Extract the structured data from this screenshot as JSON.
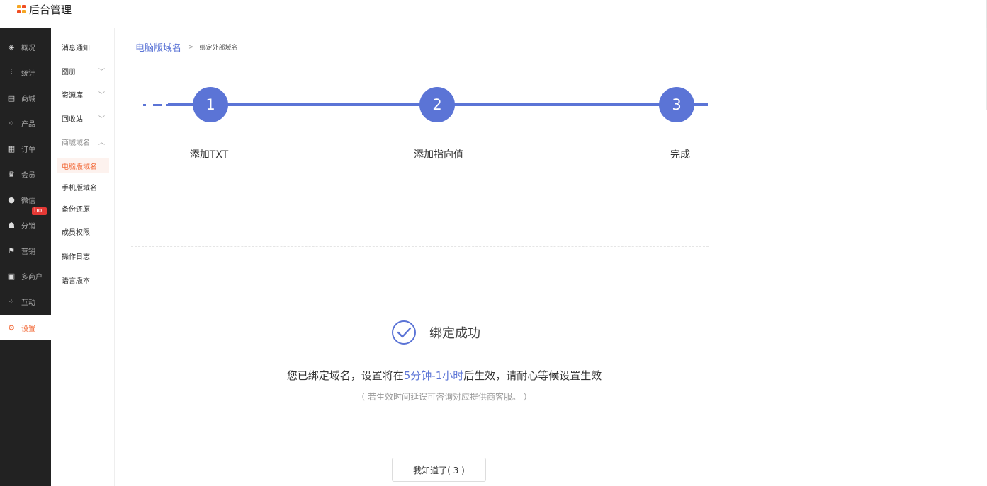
{
  "app": {
    "title": "后台管理"
  },
  "sidebar": {
    "items": [
      {
        "label": "概况",
        "icon": "layers-icon",
        "glyph": "◈"
      },
      {
        "label": "统计",
        "icon": "chart-icon",
        "glyph": "⫶"
      },
      {
        "label": "商城",
        "icon": "store-icon",
        "glyph": "▤"
      },
      {
        "label": "产品",
        "icon": "grid-icon",
        "glyph": "⁘"
      },
      {
        "label": "订单",
        "icon": "order-icon",
        "glyph": "▦"
      },
      {
        "label": "会员",
        "icon": "crown-icon",
        "glyph": "♛"
      },
      {
        "label": "微信",
        "icon": "wechat-icon",
        "glyph": "●"
      },
      {
        "label": "分销",
        "icon": "users-icon",
        "glyph": "☗"
      },
      {
        "label": "营销",
        "icon": "flag-icon",
        "glyph": "⚑"
      },
      {
        "label": "多商户",
        "icon": "merchant-icon",
        "glyph": "▣"
      },
      {
        "label": "互动",
        "icon": "interact-icon",
        "glyph": "⁘"
      },
      {
        "label": "设置",
        "icon": "gear-icon",
        "glyph": "⚙"
      }
    ],
    "hot_badge": "hot"
  },
  "subnav": {
    "items": [
      {
        "label": "消息通知",
        "chevron": ""
      },
      {
        "label": "图册",
        "chevron": "﹀"
      },
      {
        "label": "资源库",
        "chevron": "﹀"
      },
      {
        "label": "回收站",
        "chevron": "﹀"
      },
      {
        "label": "商城域名",
        "chevron": "︿"
      },
      {
        "label": "电脑版域名",
        "chevron": ""
      },
      {
        "label": "手机版域名",
        "chevron": ""
      },
      {
        "label": "备份还原",
        "chevron": ""
      },
      {
        "label": "成员权限",
        "chevron": ""
      },
      {
        "label": "操作日志",
        "chevron": ""
      },
      {
        "label": "语言版本",
        "chevron": ""
      }
    ]
  },
  "breadcrumb": {
    "main": "电脑版域名",
    "sep": ">",
    "sub": "绑定外部域名"
  },
  "steps": [
    {
      "num": "1",
      "label": "添加TXT"
    },
    {
      "num": "2",
      "label": "添加指向值"
    },
    {
      "num": "3",
      "label": "完成"
    }
  ],
  "success": {
    "title": "绑定成功",
    "msg_before": "您已绑定域名，设置将在",
    "msg_highlight": "5分钟-1小时",
    "msg_after": "后生效，请耐心等候设置生效",
    "note": "（ 若生效时间延误可咨询对应提供商客服。 ）",
    "button": "我知道了( 3 )"
  },
  "colors": {
    "accent": "#5b74d6",
    "active": "#f26b3a",
    "sidebar_bg": "#222222"
  }
}
